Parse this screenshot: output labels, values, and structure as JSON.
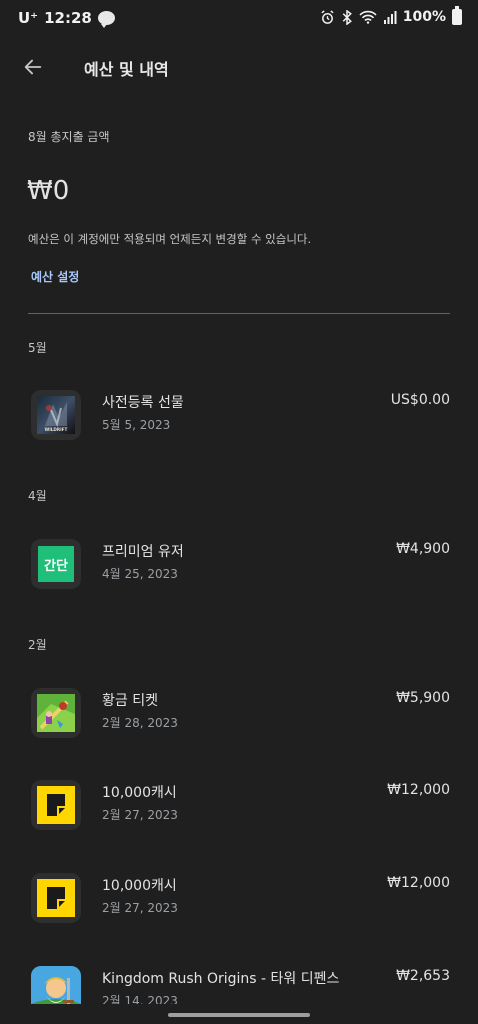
{
  "status_bar": {
    "carrier": "U⁺",
    "time": "12:28",
    "chat_badge": "talk",
    "battery": "100%"
  },
  "header": {
    "title": "예산 및 내역"
  },
  "summary": {
    "label": "8월 총지출 금액",
    "amount": "₩0",
    "note": "예산은 이 계정에만 적용되며 언제든지 변경할 수 있습니다.",
    "budget_link": "예산 설정"
  },
  "months": [
    {
      "label": "5월",
      "items": [
        {
          "title": "사전등록 선물",
          "date": "5월 5, 2023",
          "amount": "US$0.00",
          "icon": "wildrift-icon",
          "icon_text": "WILDRIFT"
        }
      ]
    },
    {
      "label": "4월",
      "items": [
        {
          "title": "프리미엄 유저",
          "date": "4월 25, 2023",
          "amount": "₩4,900",
          "icon": "gandan-icon",
          "icon_text": "간단"
        }
      ]
    },
    {
      "label": "2월",
      "items": [
        {
          "title": "황금 티켓",
          "date": "2월 28, 2023",
          "amount": "₩5,900",
          "icon": "golf-game-icon"
        },
        {
          "title": "10,000캐시",
          "date": "2월 27, 2023",
          "amount": "₩12,000",
          "icon": "yellow-page-icon"
        },
        {
          "title": "10,000캐시",
          "date": "2월 27, 2023",
          "amount": "₩12,000",
          "icon": "yellow-page-icon"
        },
        {
          "title": "Kingdom Rush Origins - 타워 디펜스",
          "date": "2월 14, 2023",
          "amount": "₩2,653",
          "icon": "kingdom-rush-icon"
        }
      ]
    }
  ],
  "colors": {
    "background": "#1f1f1f",
    "accent_link": "#a8c7fa",
    "gandan_green": "#1fbf7a",
    "yellow_app": "#ffd600"
  }
}
